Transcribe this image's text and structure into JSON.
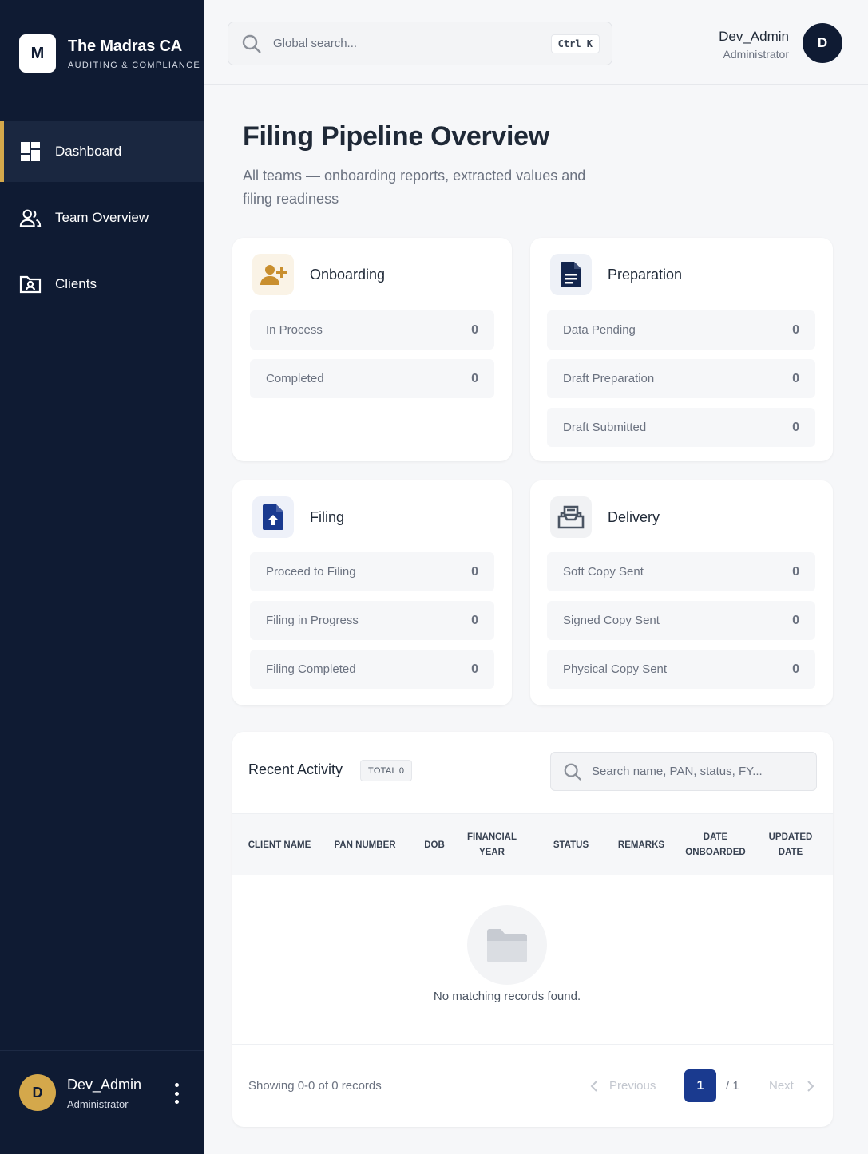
{
  "brand": {
    "logo_letter": "M",
    "name": "The Madras CA",
    "tagline": "AUDITING & COMPLIANCE"
  },
  "nav": {
    "items": [
      {
        "label": "Dashboard",
        "icon": "dashboard-icon",
        "active": true
      },
      {
        "label": "Team Overview",
        "icon": "users-icon",
        "active": false
      },
      {
        "label": "Clients",
        "icon": "folder-user-icon",
        "active": false
      }
    ]
  },
  "sidebar_user": {
    "initial": "D",
    "name": "Dev_Admin",
    "role": "Administrator"
  },
  "topbar": {
    "search_placeholder": "Global search...",
    "shortcut": "Ctrl K",
    "user_name": "Dev_Admin",
    "user_role": "Administrator",
    "user_initial": "D"
  },
  "header": {
    "title": "Filing Pipeline Overview",
    "subtitle": "All teams — onboarding reports, extracted values and filing readiness"
  },
  "cards": {
    "onboarding": {
      "title": "Onboarding",
      "rows": [
        {
          "label": "In Process",
          "value": "0"
        },
        {
          "label": "Completed",
          "value": "0"
        }
      ]
    },
    "preparation": {
      "title": "Preparation",
      "rows": [
        {
          "label": "Data Pending",
          "value": "0"
        },
        {
          "label": "Draft Preparation",
          "value": "0"
        },
        {
          "label": "Draft Submitted",
          "value": "0"
        }
      ]
    },
    "filing": {
      "title": "Filing",
      "rows": [
        {
          "label": "Proceed to Filing",
          "value": "0"
        },
        {
          "label": "Filing in Progress",
          "value": "0"
        },
        {
          "label": "Filing Completed",
          "value": "0"
        }
      ]
    },
    "delivery": {
      "title": "Delivery",
      "rows": [
        {
          "label": "Soft Copy Sent",
          "value": "0"
        },
        {
          "label": "Signed Copy Sent",
          "value": "0"
        },
        {
          "label": "Physical Copy Sent",
          "value": "0"
        }
      ]
    }
  },
  "colors": {
    "sidebar": "#0f1b33",
    "accent_gold": "#d4a84b",
    "primary_blue": "#1a3a8f"
  },
  "activity": {
    "title": "Recent Activity",
    "badge": "TOTAL 0",
    "search_placeholder": "Search name, PAN, status, FY...",
    "columns": [
      "CLIENT NAME",
      "PAN NUMBER",
      "DOB",
      "FINANCIAL YEAR",
      "STATUS",
      "REMARKS",
      "DATE ONBOARDED",
      "UPDATED DATE"
    ],
    "empty_message": "No matching records found.",
    "footer": {
      "showing": "Showing 0-0 of 0 records",
      "previous": "Previous",
      "current_page": "1",
      "total_pages": "/ 1",
      "next": "Next"
    }
  }
}
